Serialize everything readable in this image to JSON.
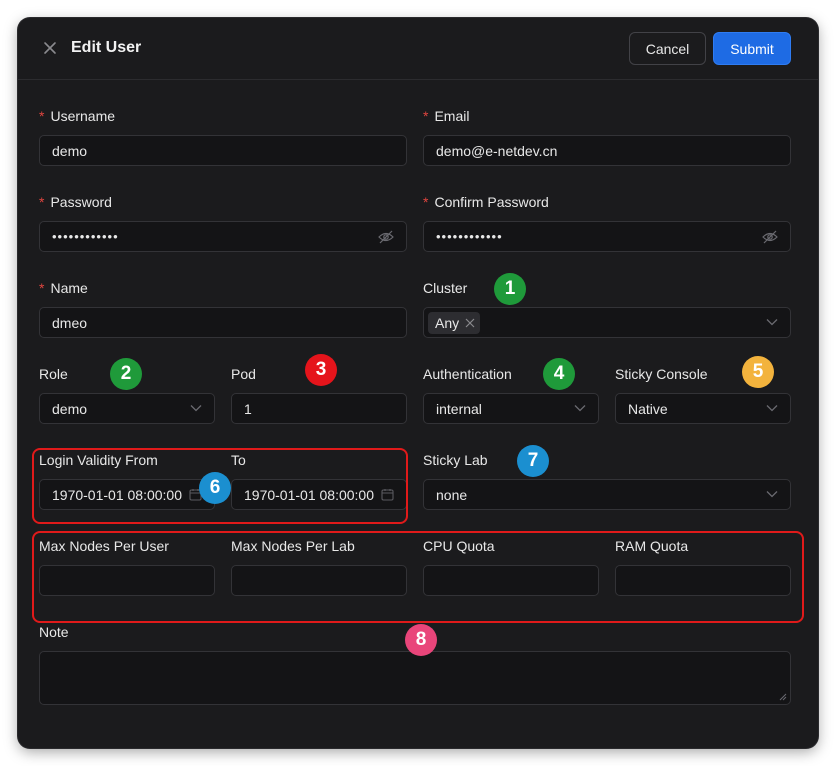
{
  "dialog": {
    "title": "Edit User",
    "cancel_label": "Cancel",
    "submit_label": "Submit",
    "required_mark": "*"
  },
  "form": {
    "username": {
      "label": "Username",
      "value": "demo"
    },
    "email": {
      "label": "Email",
      "value": "demo@e-netdev.cn"
    },
    "password": {
      "label": "Password",
      "value": "••••••••••••"
    },
    "confirm_password": {
      "label": "Confirm Password",
      "value": "••••••••••••"
    },
    "name": {
      "label": "Name",
      "value": "dmeo"
    },
    "cluster": {
      "label": "Cluster",
      "tag": "Any"
    },
    "role": {
      "label": "Role",
      "value": "demo"
    },
    "pod": {
      "label": "Pod",
      "value": "1"
    },
    "authentication": {
      "label": "Authentication",
      "value": "internal"
    },
    "sticky_console": {
      "label": "Sticky Console",
      "value": "Native"
    },
    "login_from": {
      "label": "Login Validity From",
      "value": "1970-01-01 08:00:00"
    },
    "login_to": {
      "label": "To",
      "value": "1970-01-01 08:00:00"
    },
    "sticky_lab": {
      "label": "Sticky Lab",
      "value": "none"
    },
    "max_nodes_user": {
      "label": "Max Nodes Per User",
      "value": ""
    },
    "max_nodes_lab": {
      "label": "Max Nodes Per Lab",
      "value": ""
    },
    "cpu_quota": {
      "label": "CPU Quota",
      "value": ""
    },
    "ram_quota": {
      "label": "RAM Quota",
      "value": ""
    },
    "note": {
      "label": "Note",
      "value": ""
    }
  },
  "annotations": [
    {
      "number": "1",
      "color": "#1f9a3a"
    },
    {
      "number": "2",
      "color": "#1f9a3a"
    },
    {
      "number": "3",
      "color": "#e5141b"
    },
    {
      "number": "4",
      "color": "#1f9a3a"
    },
    {
      "number": "5",
      "color": "#f3b33d"
    },
    {
      "number": "6",
      "color": "#1b8fd0"
    },
    {
      "number": "7",
      "color": "#1b8fd0"
    },
    {
      "number": "8",
      "color": "#e9457a"
    }
  ],
  "icons": {
    "close": "close-icon",
    "password_toggle": "eye-slash-icon",
    "select": "chevron-down-icon",
    "date": "calendar-icon",
    "tag_remove": "close-icon"
  },
  "colors": {
    "dialog_bg": "#1b1b1d",
    "input_bg": "#141416",
    "accent": "#1e6be4",
    "required": "#e0453f",
    "highlight_box": "#e01a1a"
  }
}
